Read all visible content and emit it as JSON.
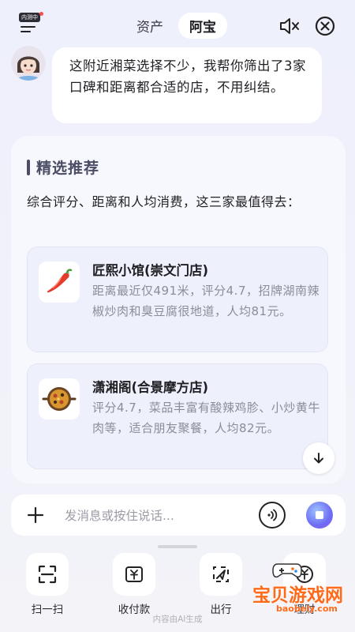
{
  "header": {
    "menu_badge": "内测中",
    "tabs": [
      {
        "label": "资产"
      },
      {
        "label": "阿宝"
      }
    ],
    "icons": {
      "menu": "menu-icon",
      "mute": "speaker-muted-icon",
      "close": "close-circle-icon"
    }
  },
  "chat": {
    "assistant_message": "这附近湘菜选择不少，我帮你筛出了3家口碑和距离都合适的店，不用纠结。"
  },
  "recommend": {
    "title": "精选推荐",
    "intro": "综合评分、距离和人均消费，这三家最值得去：",
    "shops": [
      {
        "name": "匠熙小馆(崇文门店)",
        "desc": "距离最近仅491米，评分4.7，招牌湖南辣椒炒肉和臭豆腐很地道，人均81元。",
        "icon": "chili-pepper-icon"
      },
      {
        "name": "潇湘阁(合景摩方店)",
        "desc": "评分4.7，菜品丰富有酸辣鸡胗、小炒黄牛肉等，适合朋友聚餐，人均82元。",
        "icon": "paella-pan-icon"
      }
    ]
  },
  "input": {
    "placeholder": "发消息或按住说话..."
  },
  "quick_actions": [
    {
      "label": "扫一扫",
      "icon": "scan-icon"
    },
    {
      "label": "收付款",
      "icon": "payment-icon"
    },
    {
      "label": "出行",
      "icon": "navigation-icon"
    },
    {
      "label": "理财",
      "icon": "finance-icon"
    }
  ],
  "footer_note": "内容由AI生成",
  "watermark": {
    "text": "宝贝游戏网",
    "url": "baobeiy.com"
  },
  "colors": {
    "accent_title": "#4a4d63",
    "watermark": "#ff6a1a",
    "stop_button": "#6e6cf3"
  }
}
